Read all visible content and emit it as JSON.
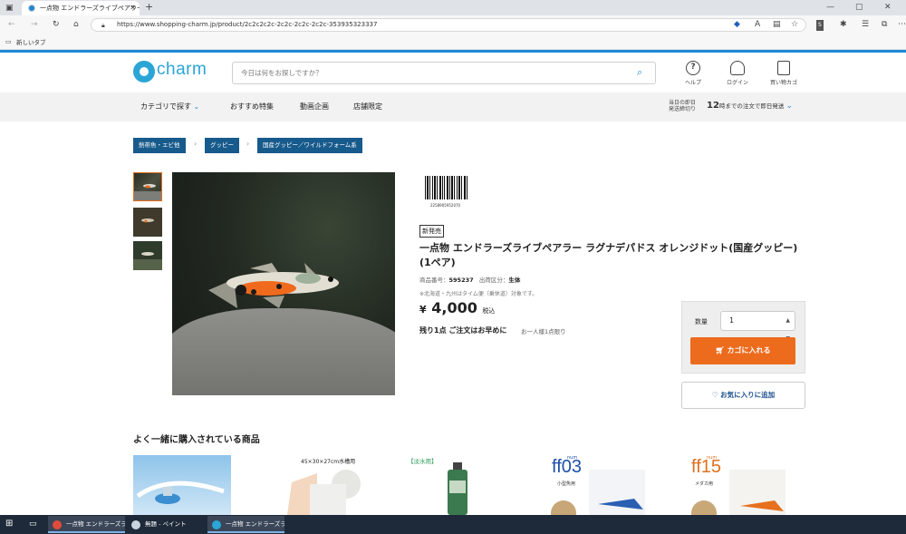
{
  "browser": {
    "tab_title": "一点物 エンドラーズライブペアラー ラ",
    "url": "https://www.shopping-charm.jp/product/2c2c2c2c-2c2c-2c2c-2c2c-353935323337",
    "favorites_item": "新しいタブ",
    "new_tab_glyph": "+",
    "close_glyph": "✕"
  },
  "site": {
    "logo_text": "charm",
    "search_placeholder": "今日は何をお探しですか？",
    "help_label": "ヘルプ",
    "login_label": "ログイン",
    "cart_label": "買い物カゴ"
  },
  "nav": {
    "items": [
      "カテゴリで探す",
      "おすすめ特集",
      "動画企画",
      "店舗限定"
    ],
    "deadline_label_line1": "当日の即日",
    "deadline_label_line2": "発送締切り",
    "deadline_hour": "12",
    "deadline_text": "時までの注文で即日発送"
  },
  "breadcrumbs": [
    "熱帯魚・エビ他",
    "グッピー",
    "国産グッピー／ワイルドフォーム系"
  ],
  "product": {
    "barcode_number": "2258905952070",
    "badge": "新発売",
    "title": "一点物 エンドラーズライブペアラー ラグナデパドス オレンジドット(国産グッピー)(1ペア)",
    "code_label": "商品番号：",
    "code": "595237",
    "ship_label": "出荷区分：",
    "ship_value": "生体",
    "note": "※北海道・九州はタイム便（乗休道）対象です。",
    "price_symbol": "¥",
    "price": "4,000",
    "tax": "税込",
    "stock": "残り1点 ご注文はお早めに",
    "limit": "お一人様1点限り"
  },
  "cart": {
    "qty_label": "数量",
    "qty_value": "1",
    "add_label": "カゴに入れる",
    "favorite_label": "お気に入りに追加"
  },
  "recommend": {
    "title": "よく一緒に購入されている商品",
    "item2_caption": "45×30×27cm水槽用",
    "item3_caption": "【淡水用】",
    "item4_label": "ff03",
    "item4_sub": "num",
    "item4_caption": "小型魚用",
    "item5_label": "ff15",
    "item5_sub": "num",
    "item5_caption": "メダカ用"
  },
  "taskbar": {
    "items": [
      "一点物 エンドラーズラ...",
      "無題 - ペイント",
      "一点物 エンドラーズラ..."
    ]
  },
  "colors": {
    "accent": "#1e88d6",
    "breadcrumb": "#175a8c",
    "cart_button": "#ed6b1c",
    "taskbar": "#1e2a3a"
  }
}
